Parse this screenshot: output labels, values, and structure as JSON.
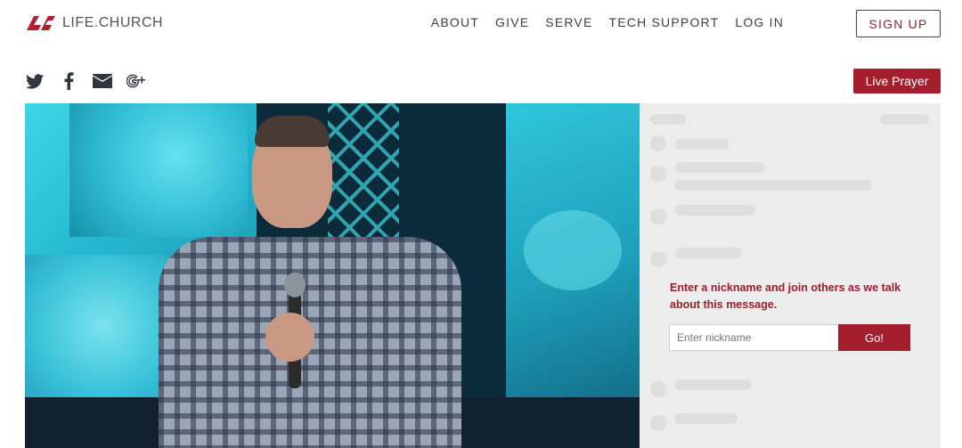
{
  "header": {
    "logo_text": "LIFE.CHURCH",
    "nav": [
      "ABOUT",
      "GIVE",
      "SERVE",
      "TECH SUPPORT",
      "LOG IN"
    ],
    "signup_label": "SIGN UP"
  },
  "social": {
    "icons": [
      "twitter-icon",
      "facebook-icon",
      "email-icon",
      "google-plus-icon"
    ]
  },
  "live_prayer_label": "Live Prayer",
  "chat": {
    "prompt": "Enter a nickname and join others as we talk about this message.",
    "nickname_placeholder": "Enter nickname",
    "go_label": "Go!"
  },
  "colors": {
    "brand_red": "#a51e2d",
    "nav_text": "#3e3e3e",
    "chat_bg": "#ececec"
  }
}
